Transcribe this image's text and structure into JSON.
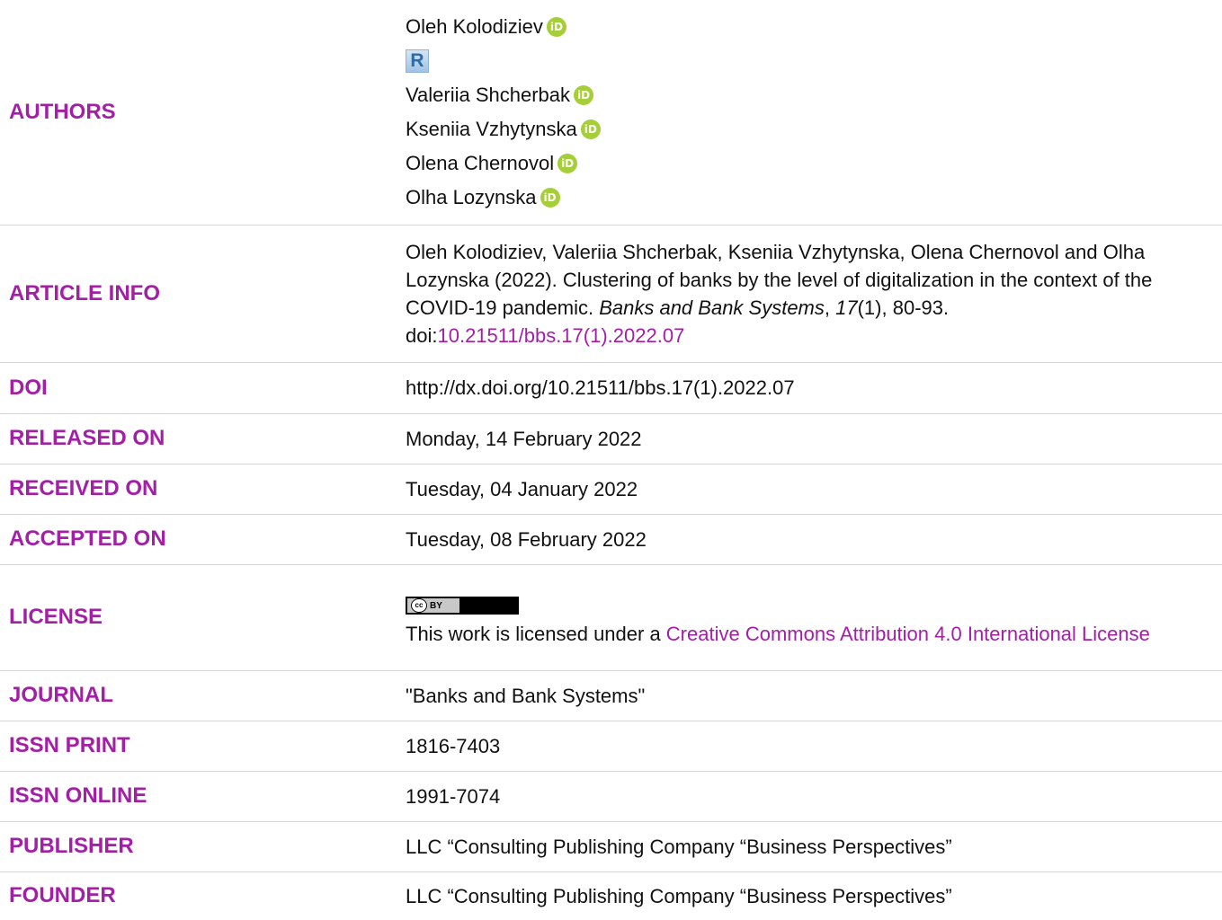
{
  "rows": {
    "authors": {
      "label": "AUTHORS",
      "names": [
        "Oleh Kolodiziev",
        "Valeriia Shcherbak",
        "Kseniia Vzhytynska",
        "Olena Chernovol",
        "Olha Lozynska"
      ],
      "orcid_icon_text": "iD",
      "researcherid_icon_text": "R"
    },
    "article_info": {
      "label": "ARTICLE INFO",
      "text_before": "Oleh Kolodiziev, Valeriia Shcherbak, Kseniia Vzhytynska, Olena Chernovol and Olha Lozynska (2022). Clustering of banks by the level of digitalization in the context of the COVID-19 pandemic. ",
      "journal_italic": "Banks and Bank Systems",
      "comma": ", ",
      "volume_italic": "17",
      "after_volume": "(1), 80-93.",
      "doi_prefix": "doi:",
      "doi_link": "10.21511/bbs.17(1).2022.07"
    },
    "doi": {
      "label": "DOI",
      "value": "http://dx.doi.org/10.21511/bbs.17(1).2022.07"
    },
    "released": {
      "label": "RELEASED ON",
      "value": "Monday, 14 February 2022"
    },
    "received": {
      "label": "RECEIVED ON",
      "value": "Tuesday, 04 January 2022"
    },
    "accepted": {
      "label": "ACCEPTED ON",
      "value": "Tuesday, 08 February 2022"
    },
    "license": {
      "label": "LICENSE",
      "badge_cc": "cc",
      "badge_by": "BY",
      "text_before": "This work is licensed under a ",
      "link_text": "Creative Commons Attribution 4.0 International License"
    },
    "journal": {
      "label": "JOURNAL",
      "value": "\"Banks and Bank Systems\""
    },
    "issn_print": {
      "label": "ISSN PRINT",
      "value": "1816-7403"
    },
    "issn_online": {
      "label": "ISSN ONLINE",
      "value": "1991-7074"
    },
    "publisher": {
      "label": "PUBLISHER",
      "value": "LLC “Consulting Publishing Company “Business Perspectives”"
    },
    "founder": {
      "label": "FOUNDER",
      "value": "LLC “Consulting Publishing Company “Business Perspectives”"
    }
  },
  "colors": {
    "label": "#a21fa6",
    "link": "#a21fa6",
    "orcid": "#a6ce39",
    "divider": "#d7d7d7"
  }
}
